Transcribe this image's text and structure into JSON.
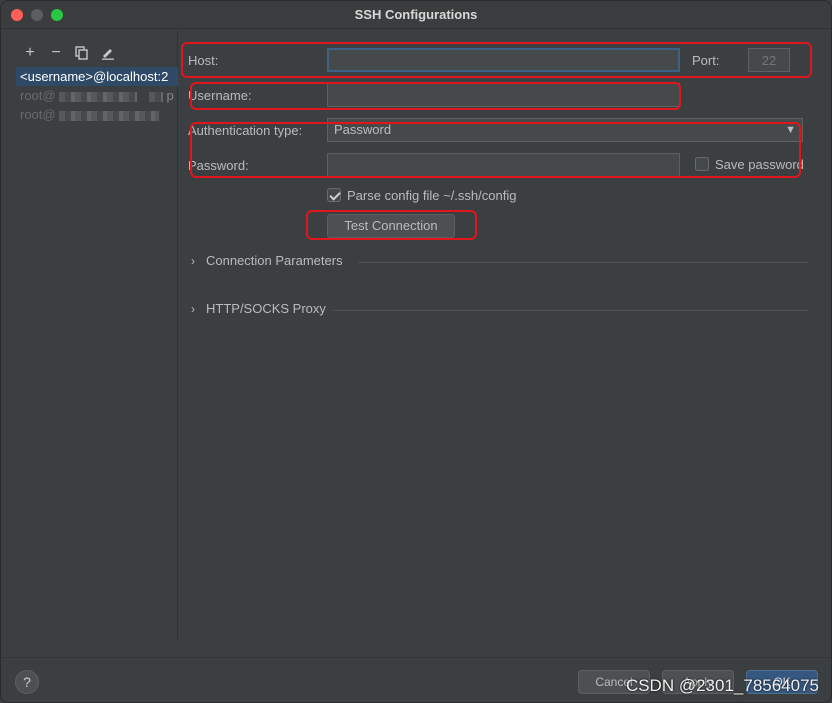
{
  "window": {
    "title": "SSH Configurations"
  },
  "sidebar": {
    "toolbar": {
      "add": "+",
      "remove": "−"
    },
    "items": [
      {
        "label": "<username>@localhost:2"
      },
      {
        "label": "root@",
        "suffix": "p"
      },
      {
        "label": "root@"
      }
    ]
  },
  "form": {
    "host_label": "Host:",
    "host_value": "",
    "port_label": "Port:",
    "port_placeholder": "22",
    "username_label": "Username:",
    "username_value": "",
    "auth_label": "Authentication type:",
    "auth_value": "Password",
    "password_label": "Password:",
    "password_value": "",
    "save_password_label": "Save password",
    "save_password_checked": false,
    "parse_config_label": "Parse config file ~/.ssh/config",
    "parse_config_checked": true,
    "test_connection_label": "Test Connection",
    "sections": [
      {
        "title": "Connection Parameters"
      },
      {
        "title": "HTTP/SOCKS Proxy"
      }
    ]
  },
  "footer": {
    "help": "?",
    "cancel": "Cancel",
    "apply": "Apply",
    "ok": "OK",
    "watermark": "CSDN @2301_78564075"
  },
  "colors": {
    "background": "#3c3f41",
    "highlight": "#e0161e",
    "selection": "#2f4a67",
    "focus": "#3d6185"
  }
}
